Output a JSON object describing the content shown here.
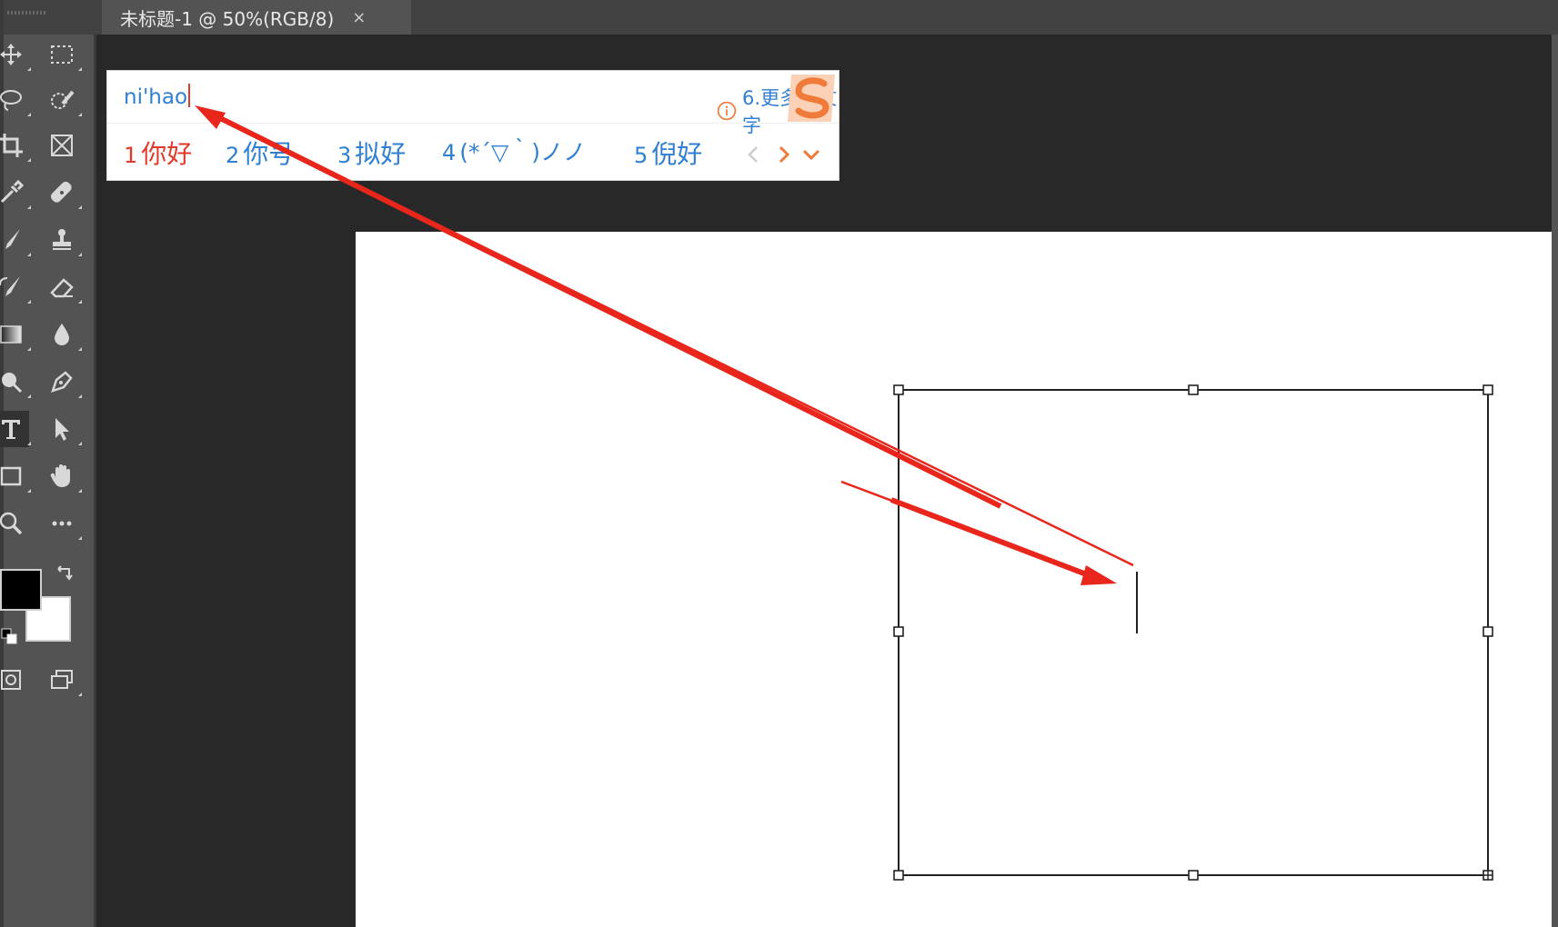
{
  "document_tab": {
    "title": "未标题-1 @ 50%(RGB/8)",
    "close_glyph": "×"
  },
  "toolbar": {
    "tools": [
      {
        "name": "move-tool-icon"
      },
      {
        "name": "marquee-tool-icon"
      },
      {
        "name": "lasso-tool-icon"
      },
      {
        "name": "quick-selection-tool-icon"
      },
      {
        "name": "crop-tool-icon"
      },
      {
        "name": "frame-tool-icon"
      },
      {
        "name": "eyedropper-tool-icon"
      },
      {
        "name": "healing-brush-tool-icon"
      },
      {
        "name": "brush-tool-icon"
      },
      {
        "name": "clone-stamp-tool-icon"
      },
      {
        "name": "history-brush-tool-icon"
      },
      {
        "name": "eraser-tool-icon"
      },
      {
        "name": "gradient-tool-icon"
      },
      {
        "name": "blur-tool-icon"
      },
      {
        "name": "dodge-tool-icon"
      },
      {
        "name": "pen-tool-icon"
      },
      {
        "name": "type-tool-icon",
        "active": true
      },
      {
        "name": "path-selection-tool-icon"
      },
      {
        "name": "rectangle-tool-icon"
      },
      {
        "name": "hand-tool-icon"
      },
      {
        "name": "zoom-tool-icon"
      },
      {
        "name": "more-tools-icon"
      }
    ],
    "foreground_color": "#000000",
    "background_color": "#ffffff"
  },
  "ime": {
    "input_text": "ni'hao",
    "more_text": "6.更多颜文字",
    "candidates": [
      {
        "num": "1",
        "text": "你好"
      },
      {
        "num": "2",
        "text": "你号"
      },
      {
        "num": "3",
        "text": "拟好"
      },
      {
        "num": "4",
        "text": "(*´▽｀)ノノ"
      },
      {
        "num": "5",
        "text": "倪好"
      }
    ],
    "accent_color": "#2f7fd2",
    "highlight_color": "#e23a2a"
  },
  "annotation": {
    "arrow_color": "#e8261c"
  }
}
